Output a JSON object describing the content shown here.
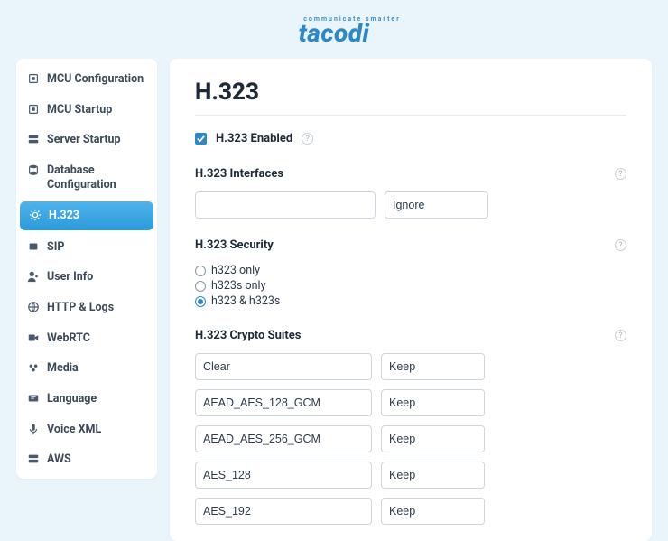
{
  "brand": {
    "tagline": "communicate smarter",
    "name": "tacodi"
  },
  "sidebar": {
    "items": [
      {
        "label": "MCU Configuration",
        "icon": "chip"
      },
      {
        "label": "MCU Startup",
        "icon": "chip"
      },
      {
        "label": "Server Startup",
        "icon": "server"
      },
      {
        "label": "Database Configuration",
        "icon": "database"
      },
      {
        "label": "H.323",
        "icon": "gear",
        "active": true
      },
      {
        "label": "SIP",
        "icon": "phone"
      },
      {
        "label": "User Info",
        "icon": "user"
      },
      {
        "label": "HTTP & Logs",
        "icon": "globe"
      },
      {
        "label": "WebRTC",
        "icon": "webrtc"
      },
      {
        "label": "Media",
        "icon": "media"
      },
      {
        "label": "Language",
        "icon": "language"
      },
      {
        "label": "Voice XML",
        "icon": "voice"
      },
      {
        "label": "AWS",
        "icon": "server"
      }
    ]
  },
  "page": {
    "title": "H.323",
    "enable_label": "H.323 Enabled",
    "enable_checked": true,
    "sections": {
      "interfaces": {
        "title": "H.323 Interfaces",
        "input_value": "",
        "action_value": "Ignore"
      },
      "security": {
        "title": "H.323 Security",
        "options": [
          {
            "label": "h323 only",
            "checked": false
          },
          {
            "label": "h323s only",
            "checked": false
          },
          {
            "label": "h323 & h323s",
            "checked": true
          }
        ]
      },
      "crypto": {
        "title": "H.323 Crypto Suites",
        "rows": [
          {
            "suite": "Clear",
            "action": "Keep"
          },
          {
            "suite": "AEAD_AES_128_GCM",
            "action": "Keep"
          },
          {
            "suite": "AEAD_AES_256_GCM",
            "action": "Keep"
          },
          {
            "suite": "AES_128",
            "action": "Keep"
          },
          {
            "suite": "AES_192",
            "action": "Keep"
          }
        ]
      }
    }
  }
}
